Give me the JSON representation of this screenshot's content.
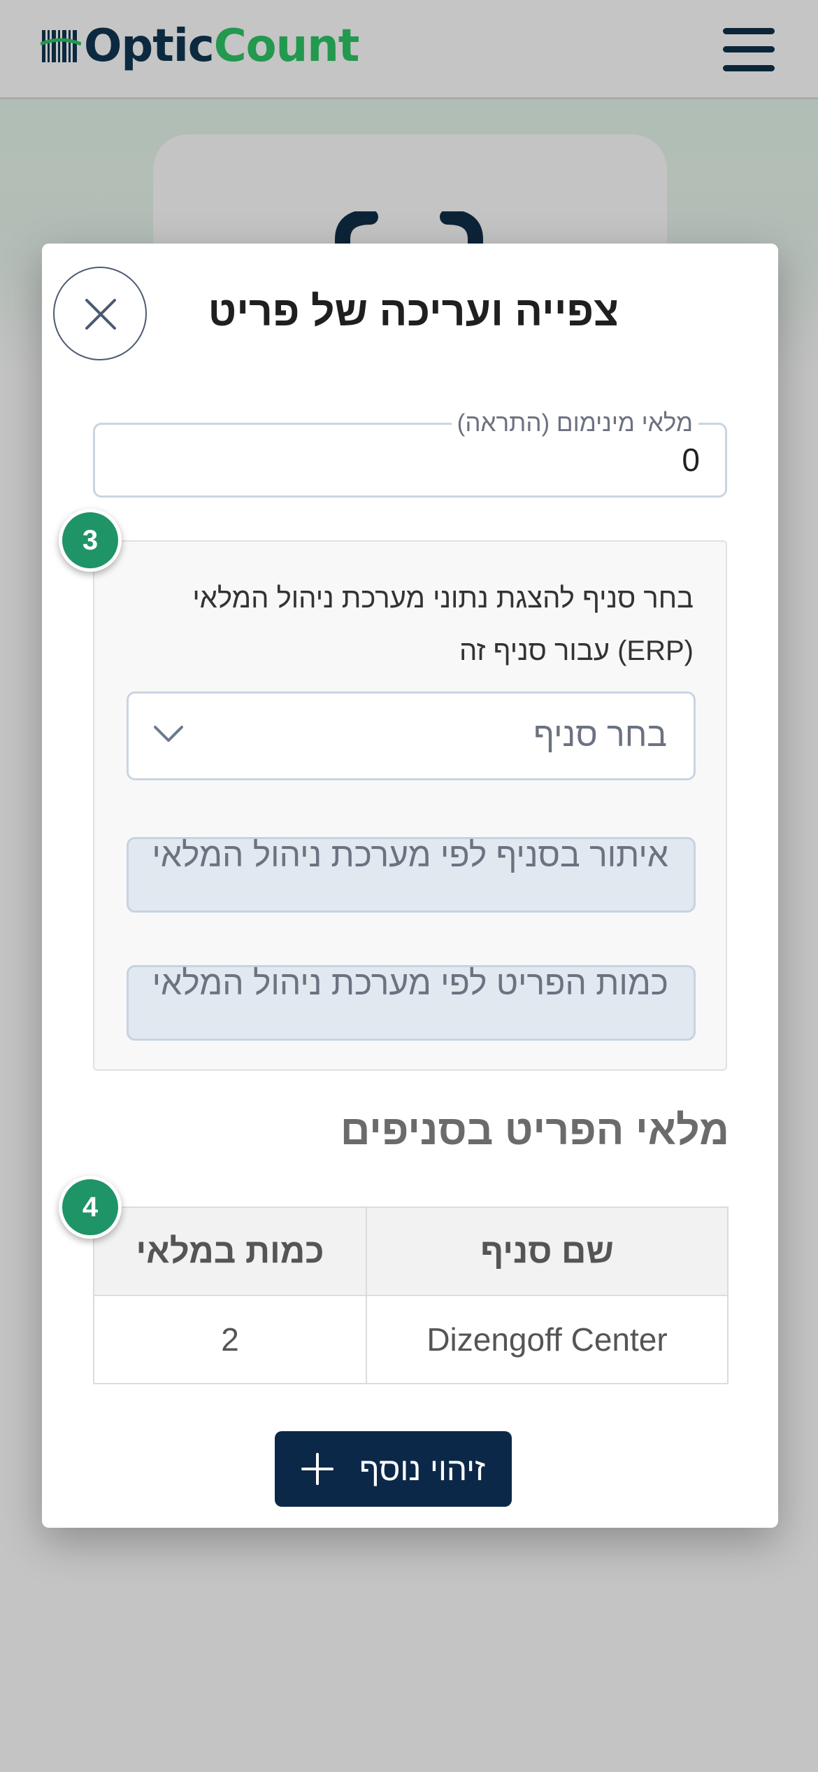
{
  "header": {
    "logo_part1": "Optic",
    "logo_part2": "Count",
    "logo_icon": "barcode-icon",
    "menu_icon": "hamburger-menu-icon"
  },
  "colors": {
    "brand_dark": "#0c2a3f",
    "brand_green": "#23984f",
    "badge_green": "#1f9467",
    "primary_button": "#0c2848",
    "readonly_bg": "#e2e8f0"
  },
  "modal": {
    "title": "צפייה ועריכה של פריט",
    "close_icon": "close-icon",
    "min_stock": {
      "label": "מלאי מינימום (התראה)",
      "value": "0"
    },
    "erp": {
      "step": "3",
      "description": "בחר סניף להצגת נתוני מערכת ניהול המלאי (ERP) עבור סניף זה",
      "branch_placeholder": "בחר סניף",
      "location_placeholder": "איתור בסניף לפי מערכת ניהול המלאי",
      "quantity_placeholder": "כמות הפריט לפי מערכת ניהול המלאי"
    },
    "stock_section": {
      "title": "מלאי הפריט בסניפים",
      "step": "4",
      "columns": [
        "שם סניף",
        "כמות במלאי"
      ],
      "rows": [
        {
          "branch": "Dizengoff Center",
          "quantity": "2"
        }
      ]
    },
    "add_button": {
      "label": "זיהוי נוסף",
      "icon": "plus-icon"
    }
  }
}
